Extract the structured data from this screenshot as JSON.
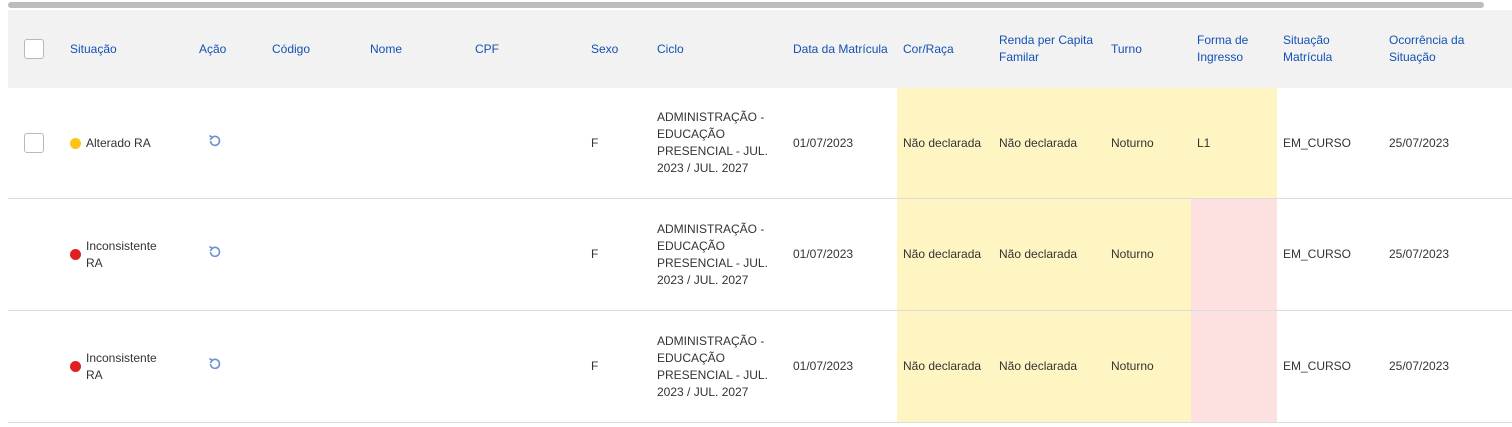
{
  "columns": {
    "situacao": "Situação",
    "acao": "Ação",
    "codigo": "Código",
    "nome": "Nome",
    "cpf": "CPF",
    "sexo": "Sexo",
    "ciclo": "Ciclo",
    "data_matricula": "Data da Matrícula",
    "cor_raca": "Cor/Raça",
    "renda": "Renda per Capita Familar",
    "turno": "Turno",
    "forma_ingresso": "Forma de Ingresso",
    "situacao_matricula": "Situação Matrícula",
    "ocorrencia": "Ocorrência da Situação"
  },
  "colors": {
    "accent": "#1351b4",
    "status_yellow": "#fcc419",
    "status_red": "#e02020",
    "highlight_yellow": "#fff5c2",
    "highlight_pink": "#fde0e0"
  },
  "rows": [
    {
      "situacao": "Alterado RA",
      "status_color": "yellow",
      "action_icon": "undo-icon",
      "codigo": "",
      "nome": "",
      "cpf": "",
      "sexo": "F",
      "ciclo": "ADMINISTRAÇÃO - EDUCAÇÃO PRESENCIAL - JUL. 2023 / JUL. 2027",
      "data_matricula": "01/07/2023",
      "cor_raca": "Não declarada",
      "renda": "Não declarada",
      "turno": "Noturno",
      "forma_ingresso": "L1",
      "situacao_matricula": "EM_CURSO",
      "ocorrencia": "25/07/2023"
    },
    {
      "situacao": "Inconsistente RA",
      "status_color": "red",
      "action_icon": "undo-icon",
      "codigo": "",
      "nome": "",
      "cpf": "",
      "sexo": "F",
      "ciclo": "ADMINISTRAÇÃO - EDUCAÇÃO PRESENCIAL - JUL. 2023 / JUL. 2027",
      "data_matricula": "01/07/2023",
      "cor_raca": "Não declarada",
      "renda": "Não declarada",
      "turno": "Noturno",
      "forma_ingresso": "",
      "situacao_matricula": "EM_CURSO",
      "ocorrencia": "25/07/2023"
    },
    {
      "situacao": "Inconsistente RA",
      "status_color": "red",
      "action_icon": "undo-icon",
      "codigo": "",
      "nome": "",
      "cpf": "",
      "sexo": "F",
      "ciclo": "ADMINISTRAÇÃO - EDUCAÇÃO PRESENCIAL - JUL. 2023 / JUL. 2027",
      "data_matricula": "01/07/2023",
      "cor_raca": "Não declarada",
      "renda": "Não declarada",
      "turno": "Noturno",
      "forma_ingresso": "",
      "situacao_matricula": "EM_CURSO",
      "ocorrencia": "25/07/2023"
    }
  ]
}
